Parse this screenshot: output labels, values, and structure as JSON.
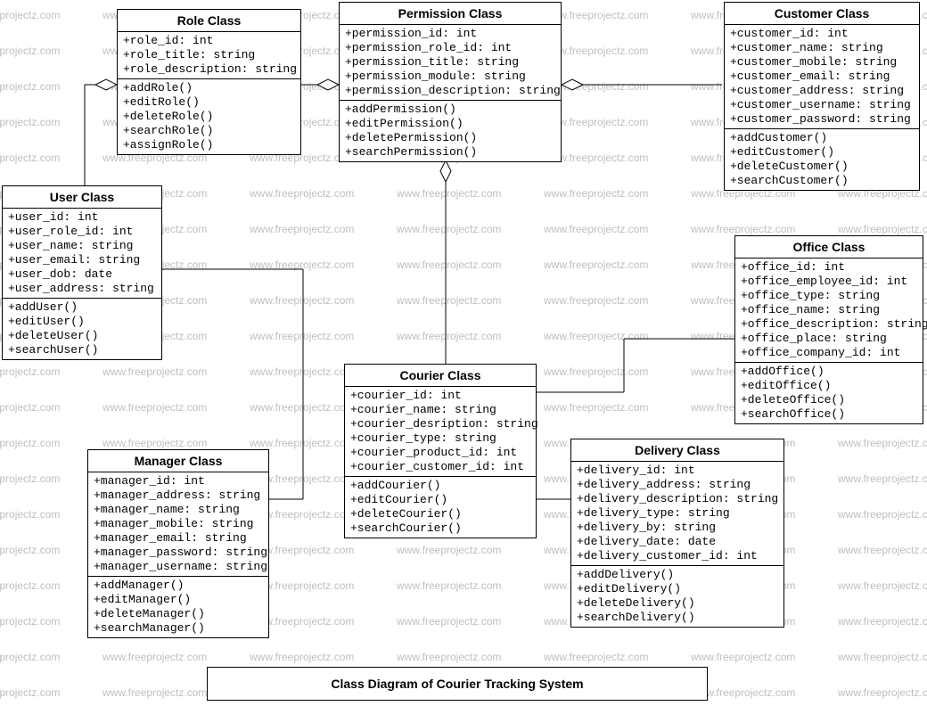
{
  "diagram_title": "Class Diagram of Courier Tracking System",
  "watermark_text": "www.freeprojectz.com",
  "chart_data": {
    "type": "uml-class-diagram",
    "classes": [
      {
        "name": "Role Class",
        "attributes": [
          "+role_id: int",
          "+role_title: string",
          "+role_description: string"
        ],
        "methods": [
          "+addRole()",
          "+editRole()",
          "+deleteRole()",
          "+searchRole()",
          "+assignRole()"
        ]
      },
      {
        "name": "Permission Class",
        "attributes": [
          "+permission_id: int",
          "+permission_role_id: int",
          "+permission_title: string",
          "+permission_module: string",
          "+permission_description: string"
        ],
        "methods": [
          "+addPermission()",
          "+editPermission()",
          "+deletePermission()",
          "+searchPermission()"
        ]
      },
      {
        "name": "Customer Class",
        "attributes": [
          "+customer_id: int",
          "+customer_name: string",
          "+customer_mobile: string",
          "+customer_email: string",
          "+customer_address: string",
          "+customer_username: string",
          "+customer_password: string"
        ],
        "methods": [
          "+addCustomer()",
          "+editCustomer()",
          "+deleteCustomer()",
          "+searchCustomer()"
        ]
      },
      {
        "name": "User Class",
        "attributes": [
          "+user_id: int",
          "+user_role_id: int",
          "+user_name: string",
          "+user_email: string",
          "+user_dob: date",
          "+user_address: string"
        ],
        "methods": [
          "+addUser()",
          "+editUser()",
          "+deleteUser()",
          "+searchUser()"
        ]
      },
      {
        "name": "Office Class",
        "attributes": [
          "+office_id: int",
          "+office_employee_id: int",
          "+office_type: string",
          "+office_name: string",
          "+office_description: string",
          "+office_place: string",
          "+office_company_id: int"
        ],
        "methods": [
          "+addOffice()",
          "+editOffice()",
          "+deleteOffice()",
          "+searchOffice()"
        ]
      },
      {
        "name": "Courier Class",
        "attributes": [
          "+courier_id: int",
          "+courier_name: string",
          "+courier_desription: string",
          "+courier_type: string",
          "+courier_product_id: int",
          "+courier_customer_id: int"
        ],
        "methods": [
          "+addCourier()",
          "+editCourier()",
          "+deleteCourier()",
          "+searchCourier()"
        ]
      },
      {
        "name": "Manager Class",
        "attributes": [
          "+manager_id: int",
          "+manager_address: string",
          "+manager_name: string",
          "+manager_mobile: string",
          "+manager_email: string",
          "+manager_password: string",
          "+manager_username: string"
        ],
        "methods": [
          "+addManager()",
          "+editManager()",
          "+deleteManager()",
          "+searchManager()"
        ]
      },
      {
        "name": "Delivery Class",
        "attributes": [
          "+delivery_id: int",
          "+delivery_address: string",
          "+delivery_description: string",
          "+delivery_type: string",
          "+delivery_by: string",
          "+delivery_date: date",
          "+delivery_customer_id: int"
        ],
        "methods": [
          "+addDelivery()",
          "+editDelivery()",
          "+deleteDelivery()",
          "+searchDelivery()"
        ]
      }
    ],
    "relationships": [
      {
        "from": "Permission Class",
        "to": "Role Class",
        "type": "aggregation-diamond-at-from"
      },
      {
        "from": "Permission Class",
        "to": "Customer Class",
        "type": "aggregation-diamond-at-from"
      },
      {
        "from": "Permission Class",
        "to": "Courier Class",
        "type": "aggregation-diamond-at-from"
      },
      {
        "from": "Role Class",
        "to": "User Class",
        "type": "aggregation-diamond-at-from"
      },
      {
        "from": "User Class",
        "to": "Manager Class",
        "type": "association"
      },
      {
        "from": "Courier Class",
        "to": "Office Class",
        "type": "association"
      },
      {
        "from": "Courier Class",
        "to": "Delivery Class",
        "type": "association"
      }
    ]
  }
}
